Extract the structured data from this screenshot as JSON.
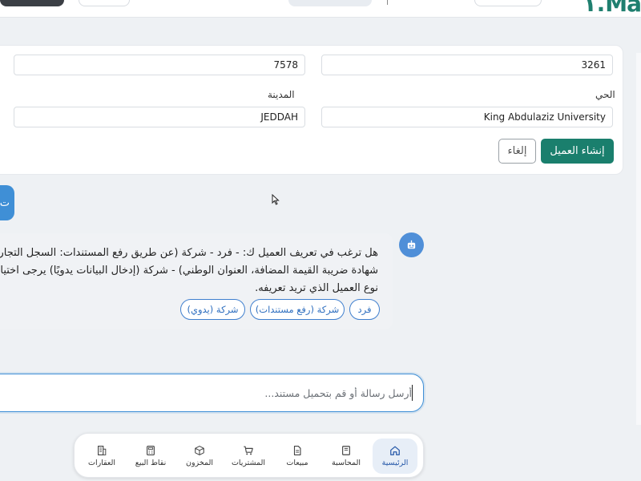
{
  "header": {
    "logo_text": "١.Ma"
  },
  "form": {
    "postal_code_value": "3261",
    "building_number_value": "7578",
    "district_label": "الحي",
    "district_value": "King Abdulaziz University",
    "city_label": "المدينة",
    "city_value": "JEDDAH",
    "create_button": "إنشاء العميل",
    "cancel_button": "إلغاء"
  },
  "side_button": {
    "label": "ت"
  },
  "chat": {
    "message_lines": [
      "هل ترغب في تعريف العميل ك: - فرد - شركة (عن طريق رفع المستندات: السجل التجاري،",
      "شهادة ضريبة القيمة المضافة، العنوان الوطني) - شركة (إدخال البيانات يدويًا) يرجى اختيار",
      "نوع العميل الذي تريد تعريفه."
    ],
    "options": [
      "فرد",
      "شركة (رفع مستندات)",
      "شركة (يدوي)"
    ],
    "input_placeholder": "أرسل رسالة أو قم بتحميل مستند..."
  },
  "bottom_nav": {
    "items": [
      {
        "label": "الرئيسية",
        "icon": "home-icon",
        "active": true
      },
      {
        "label": "المحاسبة",
        "icon": "book-icon",
        "active": false
      },
      {
        "label": "مبيعات",
        "icon": "document-icon",
        "active": false
      },
      {
        "label": "المشتريات",
        "icon": "cart-icon",
        "active": false
      },
      {
        "label": "المخزون",
        "icon": "box-icon",
        "active": false
      },
      {
        "label": "نقاط البيع",
        "icon": "calculator-icon",
        "active": false
      },
      {
        "label": "العقارات",
        "icon": "building-icon",
        "active": false
      }
    ]
  },
  "colors": {
    "primary": "#1a7f6d",
    "accent_blue": "#3f8fd6",
    "nav_active_bg": "#e7eef7"
  }
}
